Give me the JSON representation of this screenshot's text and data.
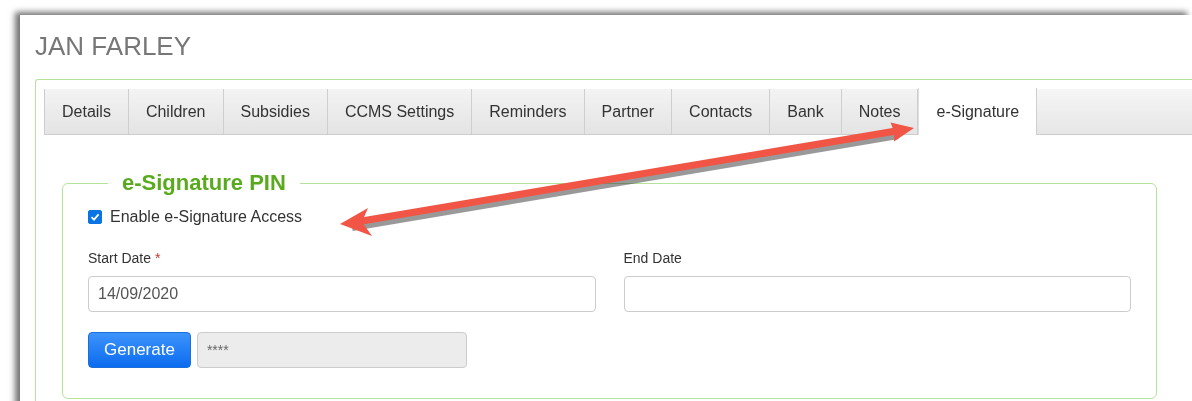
{
  "title": "JAN FARLEY",
  "tabs": [
    {
      "label": "Details",
      "selected": false
    },
    {
      "label": "Children",
      "selected": false
    },
    {
      "label": "Subsidies",
      "selected": false
    },
    {
      "label": "CCMS Settings",
      "selected": false
    },
    {
      "label": "Reminders",
      "selected": false
    },
    {
      "label": "Partner",
      "selected": false
    },
    {
      "label": "Contacts",
      "selected": false
    },
    {
      "label": "Bank",
      "selected": false
    },
    {
      "label": "Notes",
      "selected": false
    },
    {
      "label": "e-Signature",
      "selected": true
    }
  ],
  "fieldset": {
    "legend": "e-Signature PIN",
    "checkbox": {
      "label": "Enable e-Signature Access",
      "checked": true
    },
    "start_date": {
      "label": "Start Date",
      "required_mark": "*",
      "value": "14/09/2020"
    },
    "end_date": {
      "label": "End Date"
    },
    "generate_button": "Generate",
    "pin_field": {
      "value": "****",
      "disabled": true
    }
  }
}
